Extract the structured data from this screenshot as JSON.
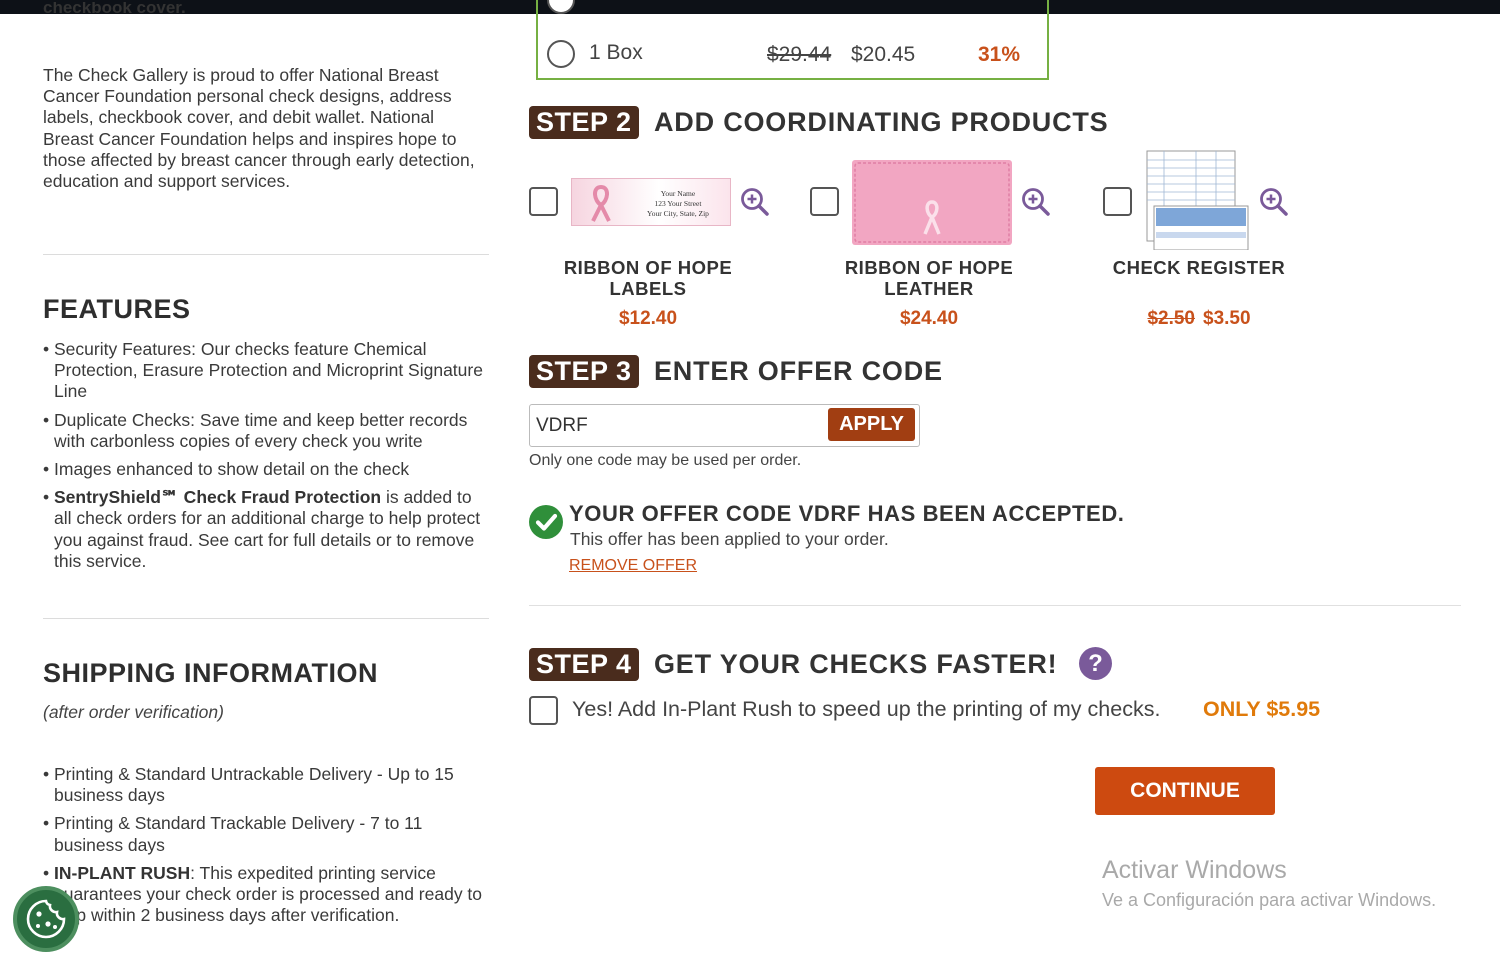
{
  "left": {
    "cut_text": "checkbook cover.",
    "intro": "The Check Gallery is proud to offer National Breast Cancer Foundation personal check designs, address labels, checkbook cover, and debit wallet. National Breast Cancer Foundation helps and inspires hope to those affected by breast cancer through early detection, education and support services.",
    "features_title": "FEATURES",
    "features": [
      "Security Features: Our checks feature Chemical Protection, Erasure Protection and Microprint Signature Line",
      "Duplicate Checks: Save time and keep better records with carbonless copies of every check you write",
      "Images enhanced to show detail on the check"
    ],
    "sentry_bold": "SentryShield℠ Check Fraud Protection",
    "sentry_rest": " is added to all check orders for an additional charge to help protect you against fraud. See cart for full details or to remove this service.",
    "shipping_title": "SHIPPING INFORMATION",
    "shipping_sub": "(after order verification)",
    "shipping": [
      "Printing & Standard Untrackable Delivery - Up to 15 business days",
      "Printing & Standard Trackable Delivery - 7 to 11 business days"
    ],
    "rush_bold": "IN-PLANT RUSH",
    "rush_rest": ": This expedited printing service guarantees your check order is processed and ready to ship within 2 business days after verification."
  },
  "quantity": {
    "label": "1 Box",
    "old_price": "$29.44",
    "price": "$20.45",
    "discount": "31%"
  },
  "step2": {
    "badge": "STEP 2",
    "title": "ADD COORDINATING PRODUCTS",
    "products": [
      {
        "name": "RIBBON OF HOPE LABELS",
        "price": "$12.40",
        "old_price": ""
      },
      {
        "name": "RIBBON OF HOPE LEATHER",
        "price": "$24.40",
        "old_price": ""
      },
      {
        "name": "CHECK REGISTER",
        "price": "$3.50",
        "old_price": "$2.50"
      }
    ],
    "label_thumb": [
      "Your Name",
      "123 Your Street",
      "Your City, State, Zip"
    ]
  },
  "step3": {
    "badge": "STEP 3",
    "title": "ENTER OFFER CODE",
    "code_value": "VDRF",
    "apply_label": "APPLY",
    "note": "Only one code may be used per order.",
    "accepted": "YOUR OFFER CODE VDRF HAS BEEN ACCEPTED.",
    "applied": "This offer has been applied to your order.",
    "remove": "REMOVE OFFER"
  },
  "step4": {
    "badge": "STEP 4",
    "title": "GET YOUR CHECKS FASTER!",
    "help": "?",
    "rush_text": "Yes! Add In-Plant Rush to speed up the printing of my checks.",
    "rush_price": "ONLY $5.95"
  },
  "continue_label": "CONTINUE",
  "windows": {
    "line1": "Activar Windows",
    "line2": "Ve a Configuración para activar Windows."
  },
  "colors": {
    "accent_orange": "#c8511b",
    "step_brown": "#4a2c1d",
    "border_green": "#76b043"
  }
}
